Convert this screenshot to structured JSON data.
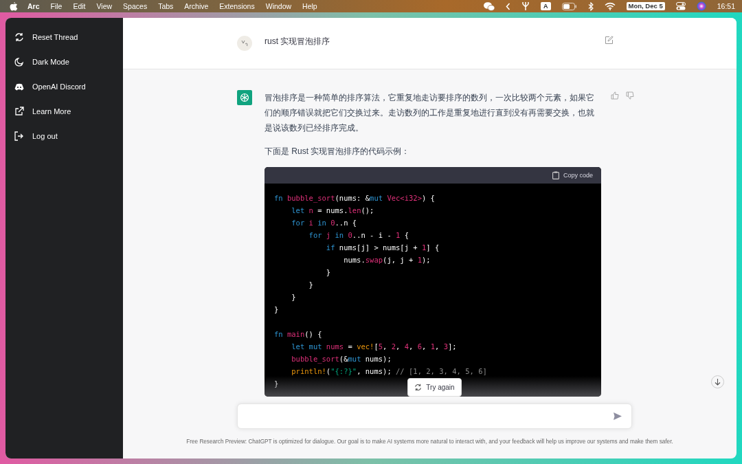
{
  "menu_bar": {
    "app": "Arc",
    "items": [
      "File",
      "Edit",
      "View",
      "Spaces",
      "Tabs",
      "Archive",
      "Extensions",
      "Window",
      "Help"
    ],
    "input_source": "A",
    "date": "Mon, Dec 5",
    "time": "16:51"
  },
  "sidebar": {
    "items": [
      {
        "kind": "reset",
        "label": "Reset Thread"
      },
      {
        "kind": "moon",
        "label": "Dark Mode"
      },
      {
        "kind": "discord",
        "label": "OpenAI Discord"
      },
      {
        "kind": "external",
        "label": "Learn More"
      },
      {
        "kind": "logout",
        "label": "Log out"
      }
    ]
  },
  "question": {
    "text": "rust 实现冒泡排序"
  },
  "answer": {
    "paragraphs": [
      "冒泡排序是一种简单的排序算法，它重复地走访要排序的数列，一次比较两个元素，如果它们的顺序错误就把它们交换过来。走访数列的工作是重复地进行直到没有再需要交换，也就是说该数列已经排序完成。",
      "下面是 Rust 实现冒泡排序的代码示例："
    ],
    "copy_label": "Copy code",
    "code_sections": [
      {
        "lines": [
          [
            {
              "kind": "keyword",
              "text": "fn "
            },
            {
              "kind": "name",
              "text": "bubble_sort"
            },
            {
              "kind": "plain",
              "text": "(nums: &"
            },
            {
              "kind": "keyword",
              "text": "mut "
            },
            {
              "kind": "name",
              "text": "Vec<i32>"
            },
            {
              "kind": "plain",
              "text": ") {"
            }
          ],
          [
            {
              "kind": "keyword",
              "text": "    let "
            },
            {
              "kind": "name",
              "text": "n"
            },
            {
              "kind": "plain",
              "text": " = nums."
            },
            {
              "kind": "name",
              "text": "len"
            },
            {
              "kind": "plain",
              "text": "();"
            }
          ],
          [
            {
              "kind": "keyword",
              "text": "    for "
            },
            {
              "kind": "name",
              "text": "i "
            },
            {
              "kind": "keyword",
              "text": "in "
            },
            {
              "kind": "number",
              "text": "0"
            },
            {
              "kind": "plain",
              "text": "..n {"
            }
          ],
          [
            {
              "kind": "keyword",
              "text": "        for "
            },
            {
              "kind": "name",
              "text": "j "
            },
            {
              "kind": "keyword",
              "text": "in "
            },
            {
              "kind": "number",
              "text": "0"
            },
            {
              "kind": "plain",
              "text": "..n - i - "
            },
            {
              "kind": "number",
              "text": "1"
            },
            {
              "kind": "plain",
              "text": " {"
            }
          ],
          [
            {
              "kind": "keyword",
              "text": "            if"
            },
            {
              "kind": "plain",
              "text": " nums[j] > nums[j + "
            },
            {
              "kind": "number",
              "text": "1"
            },
            {
              "kind": "plain",
              "text": "] {"
            }
          ],
          [
            {
              "kind": "plain",
              "text": "                nums."
            },
            {
              "kind": "name",
              "text": "swap"
            },
            {
              "kind": "plain",
              "text": "(j, j + "
            },
            {
              "kind": "number",
              "text": "1"
            },
            {
              "kind": "plain",
              "text": ");"
            }
          ],
          [
            {
              "kind": "plain",
              "text": "            }"
            }
          ],
          [
            {
              "kind": "plain",
              "text": "        }"
            }
          ],
          [
            {
              "kind": "plain",
              "text": "    }"
            }
          ],
          [
            {
              "kind": "plain",
              "text": "}"
            }
          ]
        ]
      },
      {
        "lines": [
          [
            {
              "kind": "keyword",
              "text": "fn "
            },
            {
              "kind": "name",
              "text": "main"
            },
            {
              "kind": "plain",
              "text": "() {"
            }
          ],
          [
            {
              "kind": "keyword",
              "text": "    let mut "
            },
            {
              "kind": "name",
              "text": "nums"
            },
            {
              "kind": "plain",
              "text": " = "
            },
            {
              "kind": "macro",
              "text": "vec!"
            },
            {
              "kind": "plain",
              "text": "["
            },
            {
              "kind": "number",
              "text": "5"
            },
            {
              "kind": "plain",
              "text": ", "
            },
            {
              "kind": "number",
              "text": "2"
            },
            {
              "kind": "plain",
              "text": ", "
            },
            {
              "kind": "number",
              "text": "4"
            },
            {
              "kind": "plain",
              "text": ", "
            },
            {
              "kind": "number",
              "text": "6"
            },
            {
              "kind": "plain",
              "text": ", "
            },
            {
              "kind": "number",
              "text": "1"
            },
            {
              "kind": "plain",
              "text": ", "
            },
            {
              "kind": "number",
              "text": "3"
            },
            {
              "kind": "plain",
              "text": "];"
            }
          ],
          [
            {
              "kind": "name",
              "text": "    bubble_sort"
            },
            {
              "kind": "plain",
              "text": "(&"
            },
            {
              "kind": "keyword",
              "text": "mut"
            },
            {
              "kind": "plain",
              "text": " nums);"
            }
          ],
          [
            {
              "kind": "macro",
              "text": "    println!"
            },
            {
              "kind": "plain",
              "text": "("
            },
            {
              "kind": "string",
              "text": "\"{:?}\""
            },
            {
              "kind": "plain",
              "text": ", nums); "
            },
            {
              "kind": "comment",
              "text": "// [1, 2, 3, 4, 5, 6]"
            }
          ],
          [
            {
              "kind": "plain",
              "text": "}"
            }
          ]
        ]
      }
    ]
  },
  "try_again": "Try again",
  "footer": "Free Research Preview: ChatGPT is optimized for dialogue. Our goal is to make AI systems more natural to interact with, and your feedback will help us improve our systems and make them safer."
}
